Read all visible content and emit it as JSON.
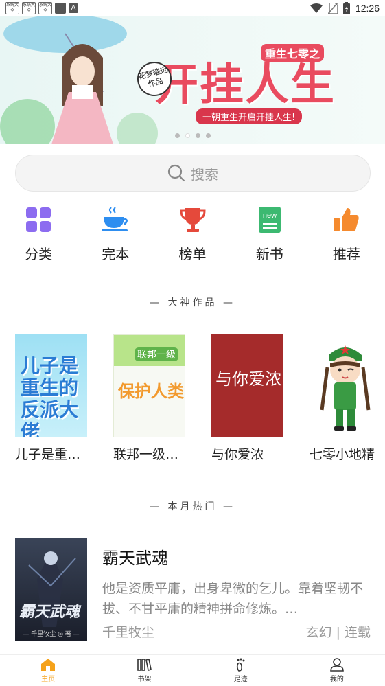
{
  "status_bar": {
    "app_icons": [
      "系统大全",
      "系统大全",
      "系统大全"
    ],
    "time": "12:26"
  },
  "banner": {
    "subtitle": "重生七零之",
    "title": "开挂人生",
    "tagline": "一朝重生开启开挂人生!",
    "author_badge": "花梦璀远作品",
    "page_count": 4,
    "active_page": 1
  },
  "search": {
    "placeholder": "搜索"
  },
  "quick_nav": [
    {
      "label": "分类",
      "icon": "grid-icon",
      "color": "#8c6cf0"
    },
    {
      "label": "完本",
      "icon": "coffee-cup-icon",
      "color": "#2e8ef0"
    },
    {
      "label": "榜单",
      "icon": "trophy-icon",
      "color": "#e5493b"
    },
    {
      "label": "新书",
      "icon": "new-book-icon",
      "color": "#3cb971"
    },
    {
      "label": "推荐",
      "icon": "thumbs-up-icon",
      "color": "#f58a2e"
    }
  ],
  "sections": {
    "masters": "— 大神作品 —",
    "monthly": "— 本月热门 —"
  },
  "master_books": [
    {
      "title": "儿子是重…",
      "cover_text": "儿子是重生的反派大佬"
    },
    {
      "title": "联邦一级…",
      "cover_text": "保护人类",
      "cover_badge": "联邦一级"
    },
    {
      "title": "与你爱浓",
      "cover_text": "与你爱浓"
    },
    {
      "title": "七零小地精"
    }
  ],
  "monthly_hot": {
    "title": "霸天武魂",
    "description": "他是资质平庸，出身卑微的乞儿。靠着坚韧不拔、不甘平庸的精神拼命修炼。…",
    "author": "千里牧尘",
    "genre": "玄幻",
    "status": "连载",
    "cover_text": "霸天武魂",
    "cover_author": "— 千里牧尘 ◎ 著 —"
  },
  "tab_bar": [
    {
      "label": "主页",
      "icon": "home-icon",
      "active": true
    },
    {
      "label": "书架",
      "icon": "bookshelf-icon",
      "active": false
    },
    {
      "label": "足迹",
      "icon": "footprint-icon",
      "active": false
    },
    {
      "label": "我的",
      "icon": "profile-icon",
      "active": false
    }
  ],
  "colors": {
    "accent": "#f5a21b",
    "banner_red": "#e94b5f"
  }
}
